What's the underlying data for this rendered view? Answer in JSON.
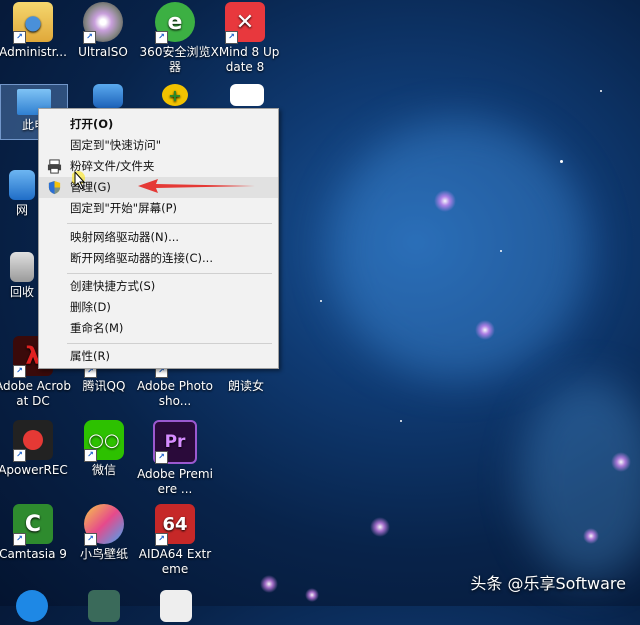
{
  "desktop": {
    "icons": [
      {
        "label": "Administr..."
      },
      {
        "label": "UltraISO"
      },
      {
        "label": "360安全浏览器"
      },
      {
        "label": "XMind 8 Update 8"
      },
      {
        "label": "此电"
      },
      {
        "label": "网"
      },
      {
        "label": "回收"
      },
      {
        "label": "Adobe Acrobat DC"
      },
      {
        "label": "腾讯QQ"
      },
      {
        "label": "Adobe Photosho..."
      },
      {
        "label": "朗读女"
      },
      {
        "label": "ApowerREC"
      },
      {
        "label": "微信"
      },
      {
        "label": "Adobe Premiere ..."
      },
      {
        "label": "Camtasia 9"
      },
      {
        "label": "小鸟壁纸"
      },
      {
        "label": "AIDA64 Extreme"
      }
    ]
  },
  "context_menu": {
    "items": [
      {
        "label": "打开(O)"
      },
      {
        "label": "固定到\"快速访问\""
      },
      {
        "label": "粉碎文件/文件夹"
      },
      {
        "label": "管理(G)"
      },
      {
        "label": "固定到\"开始\"屏幕(P)"
      },
      {
        "label": "映射网络驱动器(N)..."
      },
      {
        "label": "断开网络驱动器的连接(C)..."
      },
      {
        "label": "创建快捷方式(S)"
      },
      {
        "label": "删除(D)"
      },
      {
        "label": "重命名(M)"
      },
      {
        "label": "属性(R)"
      }
    ]
  },
  "watermark": "头条 @乐享Software",
  "colors": {
    "menu_bg": "#f2f2f2",
    "hover": "#e1e1e1",
    "arrow": "#e53935"
  }
}
